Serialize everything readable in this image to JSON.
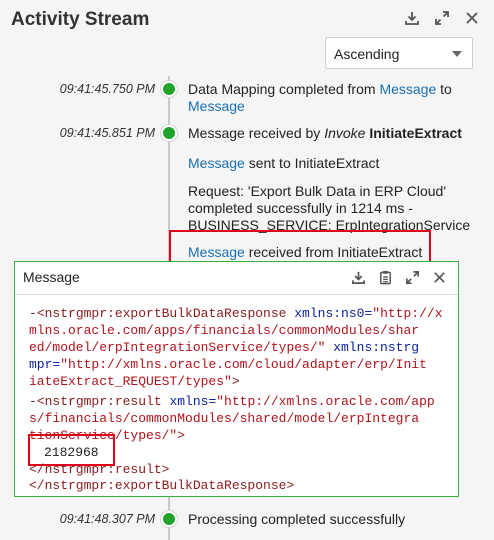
{
  "header": {
    "title": "Activity Stream",
    "icons": [
      "download-icon",
      "expand-icon",
      "close-icon"
    ]
  },
  "sort": {
    "selected": "Ascending"
  },
  "events": [
    {
      "time": "09:41:45.750 PM",
      "line1_text": "Data Mapping completed from ",
      "line1_link": "Message",
      "line1_tail": " to",
      "line2_link": "Message"
    },
    {
      "time": "09:41:45.851 PM",
      "text": "Message received by ",
      "invoke": "Invoke",
      "target": "InitiateExtract"
    },
    {
      "time": "09:41:48.307 PM",
      "text": "Processing completed successfully"
    }
  ],
  "subitems": {
    "sent_link": "Message",
    "sent_text": " sent to InitiateExtract",
    "request_lines": [
      "Request: 'Export Bulk Data in ERP Cloud'",
      "completed successfully in 1214 ms -",
      "BUSINESS_SERVICE: ErpIntegrationService"
    ],
    "received_link": "Message",
    "received_text": " received from InitiateExtract"
  },
  "message_panel": {
    "title": "Message",
    "icons": [
      "download-icon",
      "clipboard-icon",
      "expand-icon",
      "close-icon"
    ],
    "value": "2182968",
    "xml": {
      "l1_dash": "-",
      "l1_tag": "<nstrgmpr:exportBulkDataResponse",
      "l1_attr": " xmlns:ns0=",
      "l1_val": "\"http://x",
      "l2": "mlns.oracle.com/apps/financials/commonModules/shar",
      "l3_val": "ed/model/erpIntegrationService/types/\"",
      "l3_attr": " xmlns:nstrg",
      "l4_attr": "mpr=",
      "l4_val": "\"http://xmlns.oracle.com/cloud/adapter/erp/Init",
      "l5_val": "iateExtract_REQUEST/types\"",
      "l5_tag": ">",
      "r1_dash": "-",
      "r1_tag": "<nstrgmpr:result",
      "r1_attr": " xmlns=",
      "r1_val": "\"http://xmlns.oracle.com/app",
      "r2": "s/financials/commonModules/shared/model/erpIntegra",
      "r3_val": "tionService/types/\"",
      "r3_tag": ">",
      "close_result": "</nstrgmpr:result>",
      "close_response": "</nstrgmpr:exportBulkDataResponse>"
    }
  },
  "colors": {
    "accent_green": "#1ea42b",
    "link_blue": "#1a6fb3",
    "highlight_red": "#e0001b",
    "panel_border": "#3fae3f"
  }
}
